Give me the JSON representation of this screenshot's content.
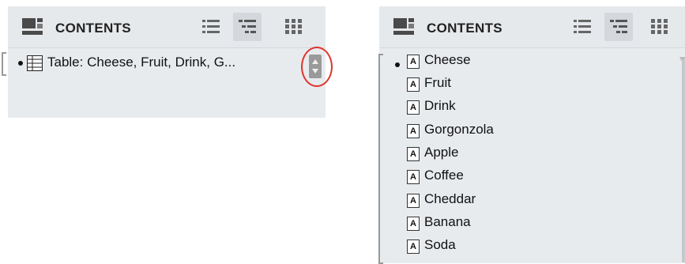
{
  "left_panel": {
    "header": {
      "title": "CONTENTS"
    },
    "row": {
      "text": "Table: Cheese, Fruit, Drink, G..."
    },
    "icons": {
      "header": "contents-panel-icon",
      "list_view": "list-view-icon",
      "outline_view": "outline-view-icon",
      "grid_view": "grid-view-icon",
      "item": "table-icon",
      "stepper": "stepper-icon"
    }
  },
  "right_panel": {
    "header": {
      "title": "CONTENTS"
    },
    "items": [
      {
        "label": "Cheese"
      },
      {
        "label": "Fruit"
      },
      {
        "label": "Drink"
      },
      {
        "label": "Gorgonzola"
      },
      {
        "label": "Apple"
      },
      {
        "label": "Coffee"
      },
      {
        "label": "Cheddar"
      },
      {
        "label": "Banana"
      },
      {
        "label": "Soda"
      }
    ],
    "item_badge": "A",
    "icons": {
      "item": "text-field-icon"
    }
  },
  "colors": {
    "highlight": "#e0322a",
    "panel_bg": "#e8ebee"
  }
}
